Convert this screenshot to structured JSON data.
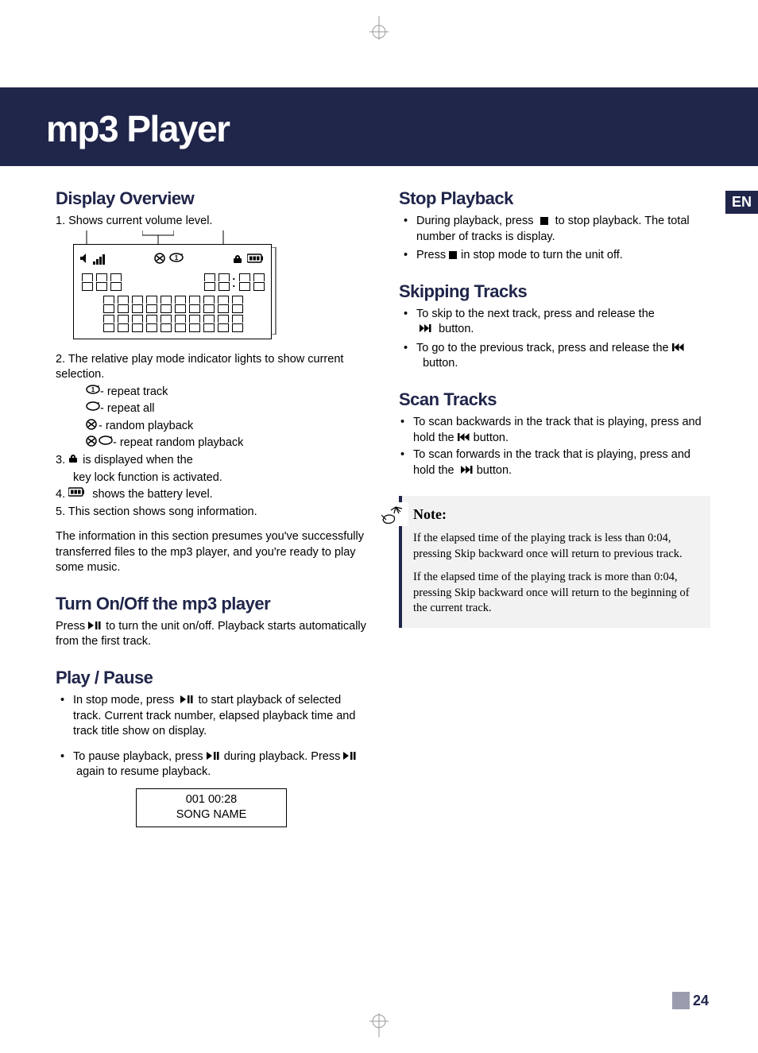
{
  "title": "mp3 Player",
  "lang_tab": "EN",
  "page_number": "24",
  "left": {
    "display_overview": {
      "heading": "Display Overview",
      "item1": "1. Shows current volume level.",
      "item2_intro": "2. The relative play mode indicator lights to show current selection.",
      "modes": {
        "repeat_track": "- repeat track",
        "repeat_all": "- repeat all",
        "random": "- random playback",
        "repeat_random": "- repeat random playback"
      },
      "item3a": "3.",
      "item3b": "is displayed when the",
      "item3c": "key lock function is activated.",
      "item4a": "4.",
      "item4b": "shows the battery level.",
      "item5": "5. This section shows song information.",
      "outro": "The information in this section presumes you've successfully transferred files to the mp3 player, and you're ready to play some music."
    },
    "turn_on_off": {
      "heading": "Turn On/Off the mp3 player",
      "text_a": "Press",
      "text_b": "to turn the unit on/off. Playback starts automatically from the first track."
    },
    "play_pause": {
      "heading": "Play / Pause",
      "li1a": "In stop mode, press",
      "li1b": "to start playback of selected track. Current track number, elapsed playback time and track title show on display.",
      "li2a": "To pause playback, press",
      "li2b": "during playback. Press",
      "li2c": "again to resume playback.",
      "lcd_line1": "001 00:28",
      "lcd_line2": "SONG NAME"
    }
  },
  "right": {
    "stop": {
      "heading": "Stop Playback",
      "li1a": "During playback, press",
      "li1b": "to stop playback. The total number of tracks is display.",
      "li2a": "Press",
      "li2b": "in stop mode to turn the unit off."
    },
    "skip": {
      "heading": "Skipping Tracks",
      "li1a": "To skip to the next track, press and release the",
      "li1b": "button.",
      "li2a": "To go to the previous track, press and release the",
      "li2b": "button."
    },
    "scan": {
      "heading": "Scan Tracks",
      "li1a": "To scan backwards in the track that is playing, press and hold the",
      "li1b": "button.",
      "li2a": "To scan forwards in the track that is playing, press and hold the",
      "li2b": "button."
    },
    "note": {
      "title": "Note:",
      "p1": "If the elapsed time of the playing track is less than 0:04, pressing Skip backward once will return to previous track.",
      "p2": "If the elapsed time of the playing track is more than 0:04, pressing Skip backward once will return to the beginning of the current track."
    }
  }
}
